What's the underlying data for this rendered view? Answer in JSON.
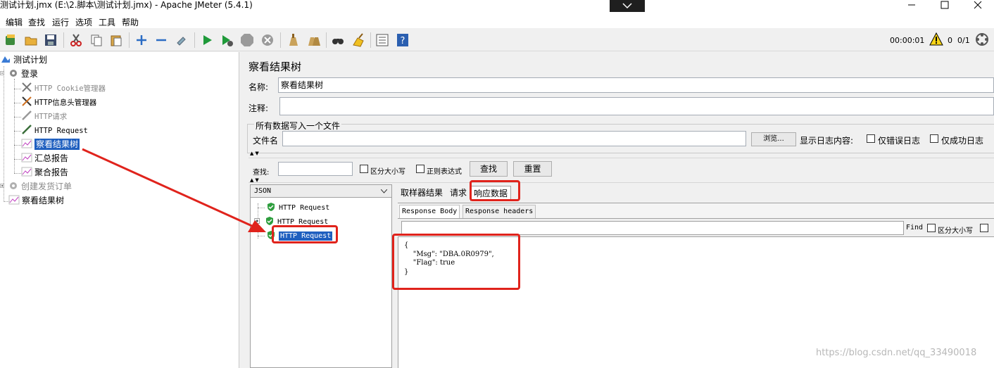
{
  "window": {
    "title": "测试计划.jmx (E:\\2.脚本\\测试计划.jmx) - Apache JMeter (5.4.1)"
  },
  "menu": [
    "编辑",
    "查找",
    "运行",
    "选项",
    "工具",
    "帮助"
  ],
  "toolbar": {
    "timer": "00:00:01",
    "warning_count": "0",
    "threads": "0/1",
    "icons": [
      "templates-icon",
      "open-icon",
      "save-icon",
      "cut-icon",
      "copy-icon",
      "paste-icon",
      "expand-icon",
      "collapse-icon",
      "toggle-icon",
      "start-icon",
      "start-no-pause-icon",
      "stop-icon",
      "shutdown-icon",
      "clear-icon",
      "clear-all-icon",
      "search-icon",
      "reset-search-icon",
      "function-helper-icon",
      "help-icon"
    ]
  },
  "test_tree": {
    "plan": "测试计划",
    "groups": [
      {
        "label": "登录",
        "enabled": true,
        "children": [
          {
            "label": "HTTP Cookie管理器",
            "enabled": false,
            "icon": "wrench-icon"
          },
          {
            "label": "HTTP信息头管理器",
            "enabled": true,
            "icon": "wrench-icon"
          },
          {
            "label": "HTTP请求",
            "enabled": false,
            "icon": "pipette-icon"
          },
          {
            "label": "HTTP Request",
            "enabled": true,
            "icon": "pipette-icon"
          },
          {
            "label": "察看结果树",
            "enabled": true,
            "selected": true,
            "icon": "chart-icon"
          },
          {
            "label": "汇总报告",
            "enabled": true,
            "icon": "chart-icon"
          },
          {
            "label": "聚合报告",
            "enabled": true,
            "icon": "chart-icon"
          }
        ]
      },
      {
        "label": "创建发货订单",
        "enabled": false,
        "children": []
      }
    ],
    "root_listener": "察看结果树"
  },
  "panel": {
    "title": "察看结果树",
    "name_label": "名称:",
    "name_value": "察看结果树",
    "comment_label": "注释:",
    "comment_value": "",
    "file_group_label": "所有数据写入一个文件",
    "filename_label": "文件名",
    "filename_value": "",
    "browse_button": "浏览...",
    "log_label": "显示日志内容:",
    "errors_only": "仅错误日志",
    "success_only": "仅成功日志"
  },
  "search": {
    "label": "查找:",
    "value": "",
    "case_sensitive": "区分大小写",
    "regex": "正则表达式",
    "find_button": "查找",
    "reset_button": "重置"
  },
  "results": {
    "renderer": "JSON",
    "samples": [
      {
        "label": "HTTP Request",
        "status": "success",
        "expandable": false
      },
      {
        "label": "HTTP Request",
        "status": "success",
        "expandable": true
      },
      {
        "label": "HTTP Request",
        "status": "success",
        "expandable": false,
        "selected": true
      }
    ]
  },
  "detail": {
    "tabs": [
      "取样器结果",
      "请求",
      "响应数据"
    ],
    "active_tab": "响应数据",
    "subtabs": [
      "Response Body",
      "Response headers"
    ],
    "find_label": "Find",
    "find_case": "区分大小写",
    "find_value": "",
    "body": "{\n    \"Msg\": \"DBA.0R0979\",\n    \"Flag\": true\n}"
  },
  "watermark": "https://blog.csdn.net/qq_33490018",
  "colors": {
    "selection": "#1f5fbf",
    "annotation_red": "#e0231c",
    "success_green": "#2e9e3e"
  }
}
